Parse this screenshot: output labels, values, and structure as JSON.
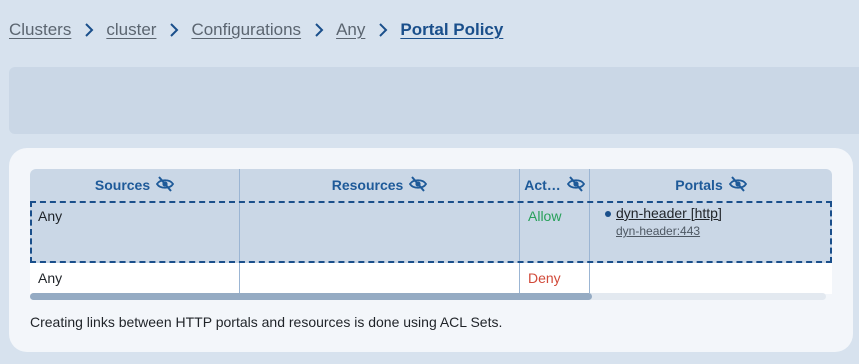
{
  "breadcrumb": {
    "items": [
      "Clusters",
      "cluster",
      "Configurations",
      "Any"
    ],
    "current": "Portal Policy"
  },
  "table": {
    "headers": [
      "Sources",
      "Resources",
      "Act…",
      "Portals"
    ],
    "rows": [
      {
        "source": "Any",
        "resource": "",
        "action": "Allow",
        "portal_name": "dyn-header [http]",
        "portal_addr": "dyn-header:443"
      },
      {
        "source": "Any",
        "resource": "",
        "action": "Deny",
        "portal_name": "",
        "portal_addr": ""
      }
    ]
  },
  "note": "Creating links between HTTP portals and resources is done using ACL Sets.",
  "icons": {
    "separator": "chevron-right-icon",
    "column_toggle": "eye-off-icon",
    "bullet": "bullet-icon"
  },
  "colors": {
    "accent": "#1a4f8b",
    "allow": "#27a05a",
    "deny": "#d14a3a"
  }
}
